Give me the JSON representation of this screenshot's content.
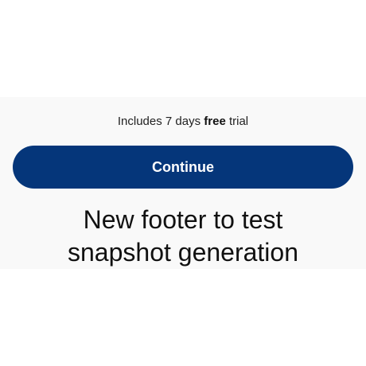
{
  "trial": {
    "prefix": "Includes 7 days ",
    "emphasis": "free",
    "suffix": " trial"
  },
  "cta": {
    "label": "Continue"
  },
  "footer": {
    "line1": "New footer to test",
    "line2": "snapshot generation"
  },
  "colors": {
    "button_bg": "#05367a",
    "button_text": "#ffffff",
    "panel_bg": "#f9f9f9"
  }
}
